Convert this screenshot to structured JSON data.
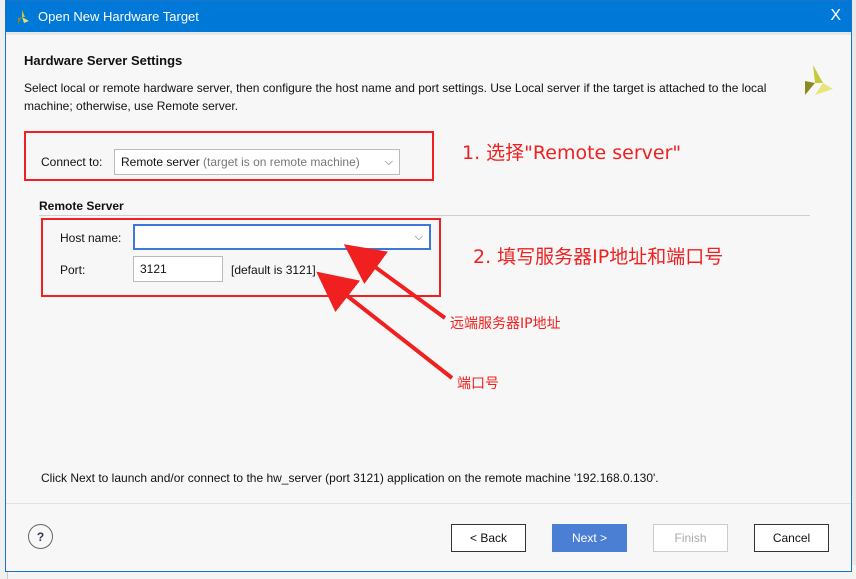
{
  "window": {
    "title": "Open New Hardware Target",
    "close_label": "X"
  },
  "page": {
    "heading": "Hardware Server Settings",
    "description": "Select local or remote hardware server, then configure the host name and port settings. Use Local server if the target is attached to the local machine; otherwise, use Remote server."
  },
  "connect": {
    "label": "Connect to:",
    "value": "Remote server",
    "hint": "(target is on remote machine)"
  },
  "remote": {
    "section": "Remote Server",
    "host_label": "Host name:",
    "host_value": "",
    "port_label": "Port:",
    "port_value": "3121",
    "port_default": "[default is 3121]"
  },
  "info": "Click Next to launch and/or connect to the hw_server (port 3121) application on the remote machine '192.168.0.130'.",
  "buttons": {
    "help": "?",
    "back": "< Back",
    "next": "Next >",
    "finish": "Finish",
    "cancel": "Cancel"
  },
  "annotations": {
    "step1": "1. 选择\"Remote server\"",
    "step2": "2. 填写服务器IP地址和端口号",
    "ip_note": "远端服务器IP地址",
    "port_note": "端口号"
  },
  "colors": {
    "titlebar": "#0078d7",
    "next_button": "#4a7fd4",
    "annotation": "#f02020"
  }
}
